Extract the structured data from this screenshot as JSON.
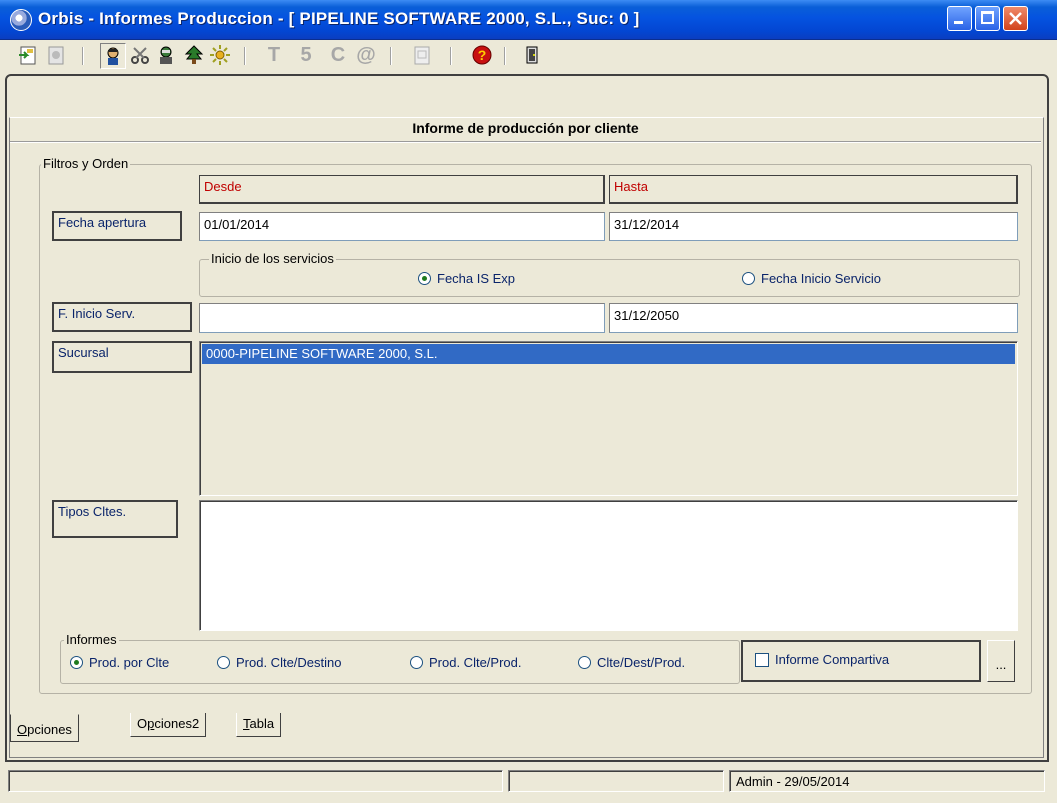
{
  "window": {
    "title": "Orbis - Informes Produccion - [ PIPELINE SOFTWARE 2000, S.L.,  Suc: 0 ]"
  },
  "toolbar": {
    "icons": [
      "import-icon",
      "export-icon",
      "client-icon",
      "scissors-icon",
      "user-icon",
      "tree-icon",
      "sun-icon",
      "t-icon",
      "s-icon",
      "c-icon",
      "at-icon",
      "document-icon",
      "help-icon",
      "exit-icon"
    ],
    "letters": {
      "t": "T",
      "s": "5",
      "c": "C",
      "at": "@"
    }
  },
  "form": {
    "title": "Informe de producción por cliente",
    "filters_group": "Filtros y Orden",
    "col_desde": "Desde",
    "col_hasta": "Hasta",
    "fecha_apertura": {
      "label": "Fecha apertura",
      "desde": "01/01/2014",
      "hasta": "31/12/2014"
    },
    "inicio_servicios": {
      "group": "Inicio de los servicios",
      "options": [
        {
          "label": "Fecha IS Exp",
          "selected": true
        },
        {
          "label": "Fecha Inicio Servicio",
          "selected": false
        }
      ]
    },
    "f_inicio_serv": {
      "label": "F. Inicio Serv.",
      "desde": "",
      "hasta": "31/12/2050"
    },
    "sucursal": {
      "label": "Sucursal",
      "items": [
        "0000-PIPELINE SOFTWARE 2000, S.L."
      ],
      "selected_index": 0
    },
    "tipos_cltes": {
      "label": "Tipos Cltes.",
      "items": []
    },
    "informes": {
      "group": "Informes",
      "options": [
        {
          "label": "Prod. por Clte",
          "selected": true
        },
        {
          "label": "Prod.  Clte/Destino",
          "selected": false
        },
        {
          "label": "Prod.  Clte/Prod.",
          "selected": false
        },
        {
          "label": "Clte/Dest/Prod.",
          "selected": false
        }
      ]
    },
    "informe_compartiva": {
      "label": "Informe Compartiva",
      "checked": false
    },
    "ellipsis": "..."
  },
  "tabs": [
    {
      "label": "Opciones",
      "mnemonic_index": 0,
      "active": true
    },
    {
      "label": "Opciones2",
      "mnemonic_index": 1,
      "active": false
    },
    {
      "label": "Tabla",
      "mnemonic_index": 0,
      "active": false
    }
  ],
  "statusbar": {
    "cell1": "",
    "cell2": "",
    "cell3": "Admin - 29/05/2014"
  }
}
